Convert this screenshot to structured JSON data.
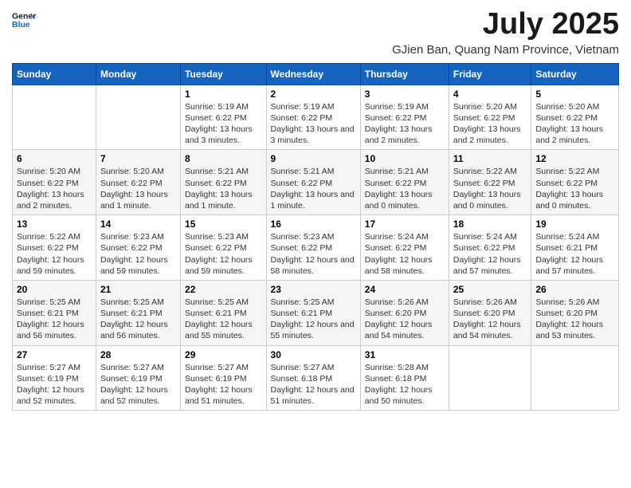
{
  "logo": {
    "line1": "General",
    "line2": "Blue"
  },
  "title": "July 2025",
  "subtitle": "GJien Ban, Quang Nam Province, Vietnam",
  "days_of_week": [
    "Sunday",
    "Monday",
    "Tuesday",
    "Wednesday",
    "Thursday",
    "Friday",
    "Saturday"
  ],
  "weeks": [
    [
      {
        "day": "",
        "info": ""
      },
      {
        "day": "",
        "info": ""
      },
      {
        "day": "1",
        "info": "Sunrise: 5:19 AM\nSunset: 6:22 PM\nDaylight: 13 hours and 3 minutes."
      },
      {
        "day": "2",
        "info": "Sunrise: 5:19 AM\nSunset: 6:22 PM\nDaylight: 13 hours and 3 minutes."
      },
      {
        "day": "3",
        "info": "Sunrise: 5:19 AM\nSunset: 6:22 PM\nDaylight: 13 hours and 2 minutes."
      },
      {
        "day": "4",
        "info": "Sunrise: 5:20 AM\nSunset: 6:22 PM\nDaylight: 13 hours and 2 minutes."
      },
      {
        "day": "5",
        "info": "Sunrise: 5:20 AM\nSunset: 6:22 PM\nDaylight: 13 hours and 2 minutes."
      }
    ],
    [
      {
        "day": "6",
        "info": "Sunrise: 5:20 AM\nSunset: 6:22 PM\nDaylight: 13 hours and 2 minutes."
      },
      {
        "day": "7",
        "info": "Sunrise: 5:20 AM\nSunset: 6:22 PM\nDaylight: 13 hours and 1 minute."
      },
      {
        "day": "8",
        "info": "Sunrise: 5:21 AM\nSunset: 6:22 PM\nDaylight: 13 hours and 1 minute."
      },
      {
        "day": "9",
        "info": "Sunrise: 5:21 AM\nSunset: 6:22 PM\nDaylight: 13 hours and 1 minute."
      },
      {
        "day": "10",
        "info": "Sunrise: 5:21 AM\nSunset: 6:22 PM\nDaylight: 13 hours and 0 minutes."
      },
      {
        "day": "11",
        "info": "Sunrise: 5:22 AM\nSunset: 6:22 PM\nDaylight: 13 hours and 0 minutes."
      },
      {
        "day": "12",
        "info": "Sunrise: 5:22 AM\nSunset: 6:22 PM\nDaylight: 13 hours and 0 minutes."
      }
    ],
    [
      {
        "day": "13",
        "info": "Sunrise: 5:22 AM\nSunset: 6:22 PM\nDaylight: 12 hours and 59 minutes."
      },
      {
        "day": "14",
        "info": "Sunrise: 5:23 AM\nSunset: 6:22 PM\nDaylight: 12 hours and 59 minutes."
      },
      {
        "day": "15",
        "info": "Sunrise: 5:23 AM\nSunset: 6:22 PM\nDaylight: 12 hours and 59 minutes."
      },
      {
        "day": "16",
        "info": "Sunrise: 5:23 AM\nSunset: 6:22 PM\nDaylight: 12 hours and 58 minutes."
      },
      {
        "day": "17",
        "info": "Sunrise: 5:24 AM\nSunset: 6:22 PM\nDaylight: 12 hours and 58 minutes."
      },
      {
        "day": "18",
        "info": "Sunrise: 5:24 AM\nSunset: 6:22 PM\nDaylight: 12 hours and 57 minutes."
      },
      {
        "day": "19",
        "info": "Sunrise: 5:24 AM\nSunset: 6:21 PM\nDaylight: 12 hours and 57 minutes."
      }
    ],
    [
      {
        "day": "20",
        "info": "Sunrise: 5:25 AM\nSunset: 6:21 PM\nDaylight: 12 hours and 56 minutes."
      },
      {
        "day": "21",
        "info": "Sunrise: 5:25 AM\nSunset: 6:21 PM\nDaylight: 12 hours and 56 minutes."
      },
      {
        "day": "22",
        "info": "Sunrise: 5:25 AM\nSunset: 6:21 PM\nDaylight: 12 hours and 55 minutes."
      },
      {
        "day": "23",
        "info": "Sunrise: 5:25 AM\nSunset: 6:21 PM\nDaylight: 12 hours and 55 minutes."
      },
      {
        "day": "24",
        "info": "Sunrise: 5:26 AM\nSunset: 6:20 PM\nDaylight: 12 hours and 54 minutes."
      },
      {
        "day": "25",
        "info": "Sunrise: 5:26 AM\nSunset: 6:20 PM\nDaylight: 12 hours and 54 minutes."
      },
      {
        "day": "26",
        "info": "Sunrise: 5:26 AM\nSunset: 6:20 PM\nDaylight: 12 hours and 53 minutes."
      }
    ],
    [
      {
        "day": "27",
        "info": "Sunrise: 5:27 AM\nSunset: 6:19 PM\nDaylight: 12 hours and 52 minutes."
      },
      {
        "day": "28",
        "info": "Sunrise: 5:27 AM\nSunset: 6:19 PM\nDaylight: 12 hours and 52 minutes."
      },
      {
        "day": "29",
        "info": "Sunrise: 5:27 AM\nSunset: 6:19 PM\nDaylight: 12 hours and 51 minutes."
      },
      {
        "day": "30",
        "info": "Sunrise: 5:27 AM\nSunset: 6:18 PM\nDaylight: 12 hours and 51 minutes."
      },
      {
        "day": "31",
        "info": "Sunrise: 5:28 AM\nSunset: 6:18 PM\nDaylight: 12 hours and 50 minutes."
      },
      {
        "day": "",
        "info": ""
      },
      {
        "day": "",
        "info": ""
      }
    ]
  ]
}
